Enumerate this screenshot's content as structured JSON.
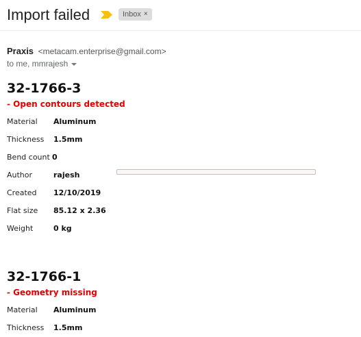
{
  "email": {
    "subject": "Import failed",
    "label": "Inbox",
    "label_remove": "×",
    "sender_name": "Praxis",
    "sender_email": "<metacam.enterprise@gmail.com>",
    "recipients": "to me, mmrajesh"
  },
  "parts": [
    {
      "id": "32-1766-3",
      "error": "- Open contours detected",
      "props": [
        {
          "label": "Material",
          "value": "Aluminum"
        },
        {
          "label": "Thickness",
          "value": "1.5mm"
        },
        {
          "label": "Bend count",
          "value": "0"
        },
        {
          "label": "Author",
          "value": "rajesh"
        },
        {
          "label": "Created",
          "value": "12/10/2019"
        },
        {
          "label": "Flat size",
          "value": "85.12 x 2.36"
        },
        {
          "label": "Weight",
          "value": "0 kg"
        }
      ]
    },
    {
      "id": "32-1766-1",
      "error": "- Geometry missing",
      "props": [
        {
          "label": "Material",
          "value": "Aluminum"
        },
        {
          "label": "Thickness",
          "value": "1.5mm"
        }
      ]
    }
  ],
  "progress": {
    "fraction": 0.0
  },
  "colors": {
    "error": "#e00000",
    "importance_marker": "#f4c20d"
  },
  "icons": {
    "importance": "importance-marker-icon",
    "remove_label": "close-icon",
    "details": "chevron-down-icon"
  }
}
